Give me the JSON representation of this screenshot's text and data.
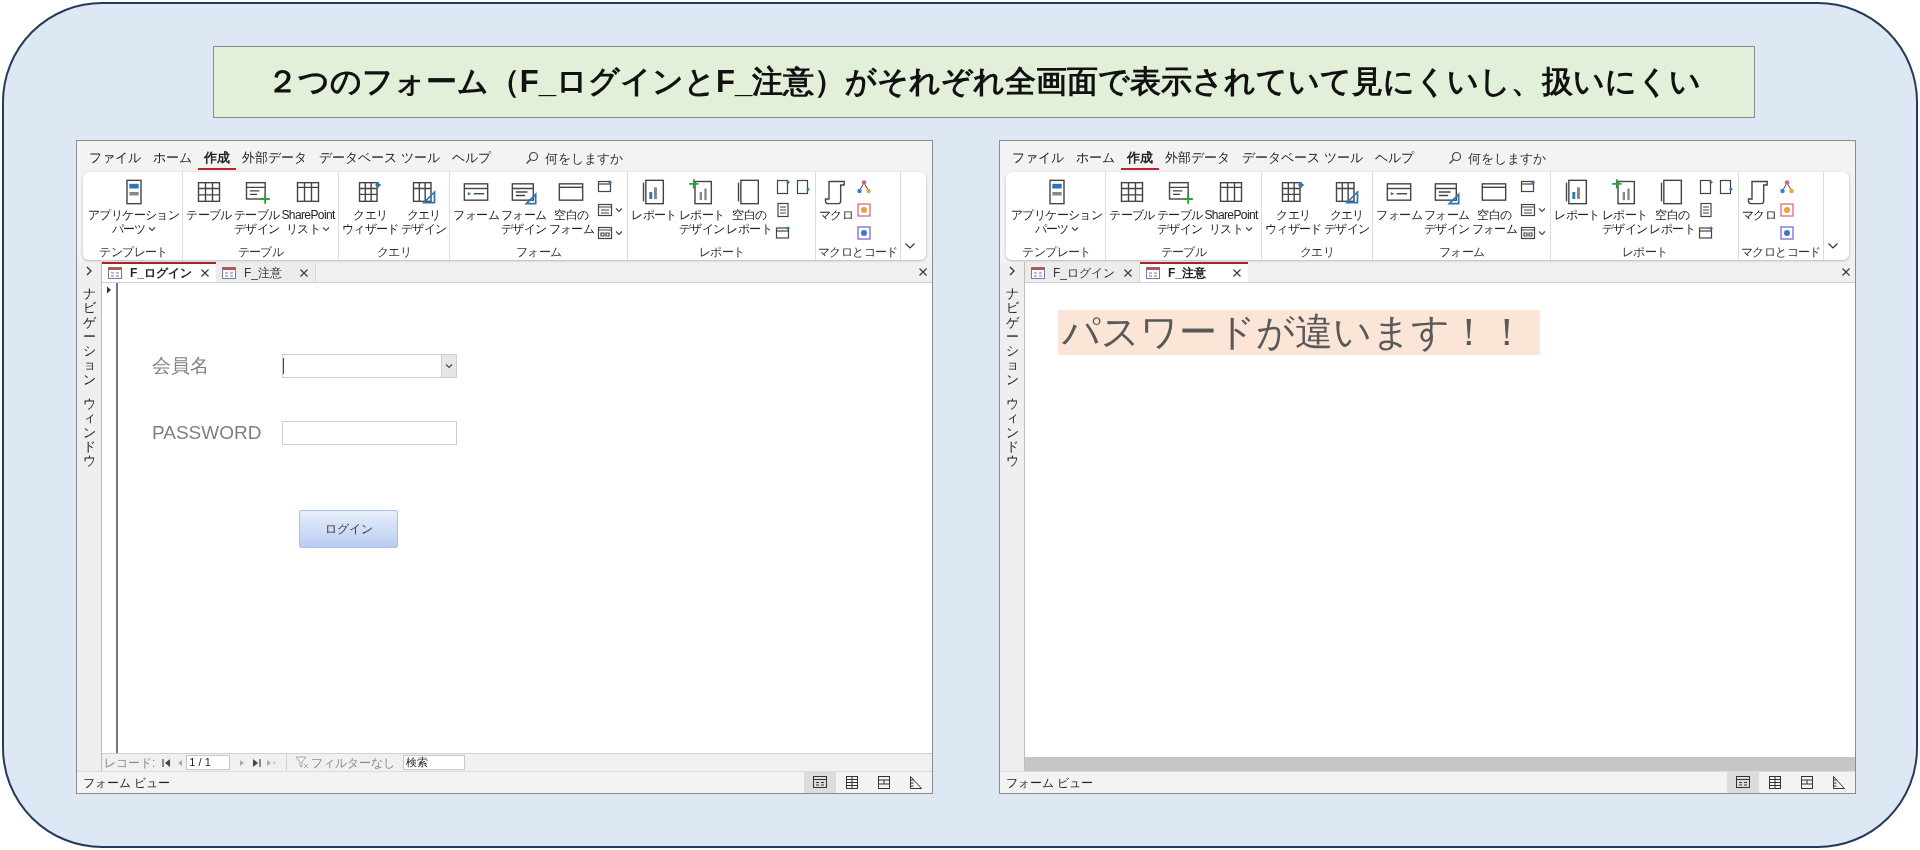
{
  "slide": {
    "title": "２つのフォーム（F_ログインとF_注意）がそれぞれ全画面で表示されていて見にくいし、扱いにくい"
  },
  "windows": [
    {
      "menu": [
        {
          "label": "ファイル",
          "selected": false
        },
        {
          "label": "ホーム",
          "selected": false
        },
        {
          "label": "作成",
          "selected": true
        },
        {
          "label": "外部データ",
          "selected": false
        },
        {
          "label": "データベース ツール",
          "selected": false
        },
        {
          "label": "ヘルプ",
          "selected": false
        }
      ],
      "search": {
        "placeholder": "何をしますか"
      },
      "ribbon": [
        {
          "label": "テンプレート",
          "items": [
            {
              "kind": "large",
              "lines": [
                "アプリケーション",
                "パーツ"
              ],
              "dropdown": true
            }
          ]
        },
        {
          "label": "テーブル",
          "items": [
            {
              "kind": "large",
              "lines": [
                "テーブル"
              ],
              "dropdown": false
            },
            {
              "kind": "large",
              "lines": [
                "テーブル",
                "デザイン"
              ],
              "dropdown": false
            },
            {
              "kind": "large",
              "lines": [
                "SharePoint",
                "リスト"
              ],
              "dropdown": true
            }
          ]
        },
        {
          "label": "クエリ",
          "items": [
            {
              "kind": "large",
              "lines": [
                "クエリ",
                "ウィザード"
              ],
              "dropdown": false
            },
            {
              "kind": "large",
              "lines": [
                "クエリ",
                "デザイン"
              ],
              "dropdown": false
            }
          ]
        },
        {
          "label": "フォーム",
          "items": [
            {
              "kind": "large",
              "lines": [
                "フォーム"
              ],
              "dropdown": false
            },
            {
              "kind": "large",
              "lines": [
                "フォーム",
                "デザイン"
              ],
              "dropdown": false
            },
            {
              "kind": "large",
              "lines": [
                "空白の",
                "フォーム"
              ],
              "dropdown": false
            },
            {
              "kind": "stack",
              "items": [
                {
                  "dropdown": false
                },
                {
                  "dropdown": true
                },
                {
                  "dropdown": true
                }
              ]
            }
          ]
        },
        {
          "label": "レポート",
          "items": [
            {
              "kind": "large",
              "lines": [
                "レポート"
              ],
              "dropdown": false
            },
            {
              "kind": "large",
              "lines": [
                "レポート",
                "デザイン"
              ],
              "dropdown": false
            },
            {
              "kind": "large",
              "lines": [
                "空白の",
                "レポート"
              ],
              "dropdown": false
            },
            {
              "kind": "stack",
              "items": [
                {
                  "dropdown": false
                },
                {
                  "dropdown": false
                },
                {
                  "dropdown": false
                }
              ]
            },
            {
              "kind": "stack",
              "items": [
                {
                  "dropdown": false
                }
              ]
            }
          ]
        },
        {
          "label": "マクロとコード",
          "items": [
            {
              "kind": "large",
              "lines": [
                "マクロ"
              ],
              "dropdown": false
            },
            {
              "kind": "stack",
              "items": [
                {
                  "dropdown": false
                },
                {
                  "dropdown": false
                },
                {
                  "dropdown": false
                }
              ]
            }
          ]
        }
      ],
      "nav_pane": {
        "labels": [
          "ナビゲーション",
          "ウィンドウ"
        ]
      },
      "doc_tabs": [
        {
          "label": "F_ログイン",
          "selected": true
        },
        {
          "label": "F_注意",
          "selected": false
        }
      ],
      "form": {
        "kind": "login",
        "fields": [
          {
            "label": "会員名",
            "kind": "combo"
          },
          {
            "label": "PASSWORD",
            "kind": "text"
          }
        ],
        "button": "ログイン"
      },
      "record_nav": {
        "label": "レコード:",
        "position": "1 / 1",
        "filter": "フィルターなし",
        "search": "検索"
      },
      "status": "フォーム ビュー",
      "views": [
        {
          "selected": true
        },
        {
          "selected": false
        },
        {
          "selected": false
        },
        {
          "selected": false
        }
      ]
    },
    {
      "menu": [
        {
          "label": "ファイル",
          "selected": false
        },
        {
          "label": "ホーム",
          "selected": false
        },
        {
          "label": "作成",
          "selected": true
        },
        {
          "label": "外部データ",
          "selected": false
        },
        {
          "label": "データベース ツール",
          "selected": false
        },
        {
          "label": "ヘルプ",
          "selected": false
        }
      ],
      "search": {
        "placeholder": "何をしますか"
      },
      "ribbon": [
        {
          "label": "テンプレート",
          "items": [
            {
              "kind": "large",
              "lines": [
                "アプリケーション",
                "パーツ"
              ],
              "dropdown": true
            }
          ]
        },
        {
          "label": "テーブル",
          "items": [
            {
              "kind": "large",
              "lines": [
                "テーブル"
              ],
              "dropdown": false
            },
            {
              "kind": "large",
              "lines": [
                "テーブル",
                "デザイン"
              ],
              "dropdown": false
            },
            {
              "kind": "large",
              "lines": [
                "SharePoint",
                "リスト"
              ],
              "dropdown": true
            }
          ]
        },
        {
          "label": "クエリ",
          "items": [
            {
              "kind": "large",
              "lines": [
                "クエリ",
                "ウィザード"
              ],
              "dropdown": false
            },
            {
              "kind": "large",
              "lines": [
                "クエリ",
                "デザイン"
              ],
              "dropdown": false
            }
          ]
        },
        {
          "label": "フォーム",
          "items": [
            {
              "kind": "large",
              "lines": [
                "フォーム"
              ],
              "dropdown": false
            },
            {
              "kind": "large",
              "lines": [
                "フォーム",
                "デザイン"
              ],
              "dropdown": false
            },
            {
              "kind": "large",
              "lines": [
                "空白の",
                "フォーム"
              ],
              "dropdown": false
            },
            {
              "kind": "stack",
              "items": [
                {
                  "dropdown": false
                },
                {
                  "dropdown": true
                },
                {
                  "dropdown": true
                }
              ]
            }
          ]
        },
        {
          "label": "レポート",
          "items": [
            {
              "kind": "large",
              "lines": [
                "レポート"
              ],
              "dropdown": false
            },
            {
              "kind": "large",
              "lines": [
                "レポート",
                "デザイン"
              ],
              "dropdown": false
            },
            {
              "kind": "large",
              "lines": [
                "空白の",
                "レポート"
              ],
              "dropdown": false
            },
            {
              "kind": "stack",
              "items": [
                {
                  "dropdown": false
                },
                {
                  "dropdown": false
                },
                {
                  "dropdown": false
                }
              ]
            },
            {
              "kind": "stack",
              "items": [
                {
                  "dropdown": false
                }
              ]
            }
          ]
        },
        {
          "label": "マクロとコード",
          "items": [
            {
              "kind": "large",
              "lines": [
                "マクロ"
              ],
              "dropdown": false
            },
            {
              "kind": "stack",
              "items": [
                {
                  "dropdown": false
                },
                {
                  "dropdown": false
                },
                {
                  "dropdown": false
                }
              ]
            }
          ]
        }
      ],
      "nav_pane": {
        "labels": [
          "ナビゲーション",
          "ウィンドウ"
        ]
      },
      "doc_tabs": [
        {
          "label": "F_ログイン",
          "selected": false
        },
        {
          "label": "F_注意",
          "selected": true
        }
      ],
      "form": {
        "kind": "notice",
        "message": "パスワードが違います！！"
      },
      "status": "フォーム ビュー",
      "views": [
        {
          "selected": true
        },
        {
          "selected": false
        },
        {
          "selected": false
        },
        {
          "selected": false
        }
      ]
    }
  ]
}
